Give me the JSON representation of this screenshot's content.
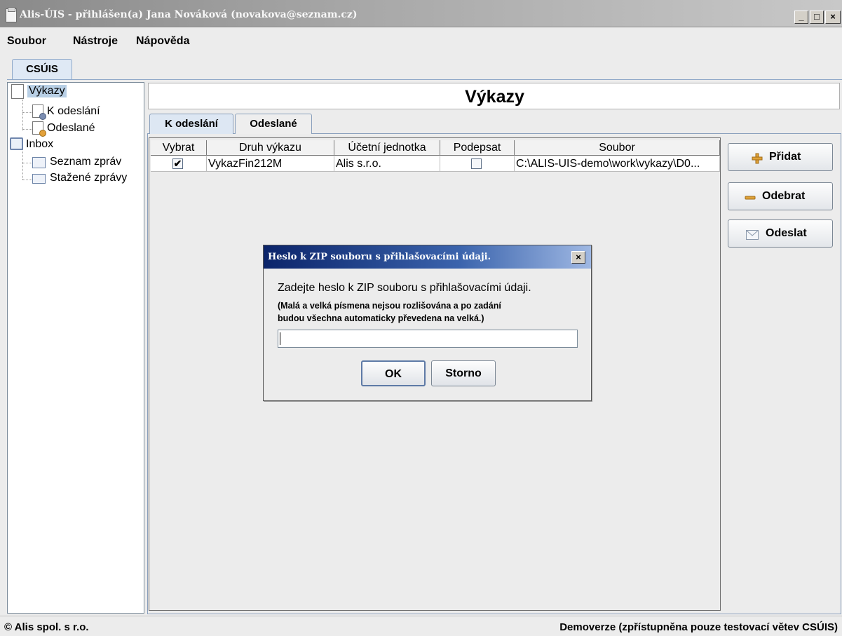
{
  "window": {
    "title": "Alis-ÚIS - přihlášen(a) Jana Nováková (novakova@seznam.cz)",
    "min_glyph": "_",
    "max_glyph": "□",
    "close_glyph": "×"
  },
  "menu": [
    "Soubor",
    "Nástroje",
    "Nápověda"
  ],
  "app_tab": "CSÚIS",
  "tree": {
    "vykazy": "Výkazy",
    "k_odeslani": "K odeslání",
    "odeslane": "Odeslané",
    "inbox": "Inbox",
    "seznam_zprav": "Seznam zpráv",
    "stazene_zpravy": "Stažené zprávy"
  },
  "main": {
    "title": "Výkazy",
    "tabs": [
      "K odeslání",
      "Odeslané"
    ],
    "active_tab": "K odeslání"
  },
  "table": {
    "columns": [
      "Vybrat",
      "Druh výkazu",
      "Účetní jednotka",
      "Podepsat",
      "Soubor"
    ],
    "rows": [
      {
        "vybrat": true,
        "druh": "VykazFin212M",
        "jednotka": "Alis s.r.o.",
        "podepsat": false,
        "soubor": "C:\\ALIS-UIS-demo\\work\\vykazy\\D0..."
      }
    ]
  },
  "actions": {
    "pridat": "Přidat",
    "odebrat": "Odebrat",
    "odeslat": "Odeslat"
  },
  "dialog": {
    "title": "Heslo k ZIP souboru s přihlašovacími údaji.",
    "prompt": "Zadejte heslo k ZIP souboru s přihlašovacími údaji.",
    "note_line1": "(Malá a velká písmena nejsou rozlišována a po zadání",
    "note_line2": "budou všechna automaticky převedena na velká.)",
    "input_value": "",
    "ok": "OK",
    "cancel": "Storno",
    "close_glyph": "×"
  },
  "status": {
    "left": "© Alis spol. s r.o.",
    "right": "Demoverze (zpřístupněna pouze testovací větev CSÚIS)"
  },
  "colors": {
    "dialog_title_bg": "#0b246a",
    "tab_active_bg": "#dde7f3",
    "tree_selection": "#b8cfe5"
  }
}
